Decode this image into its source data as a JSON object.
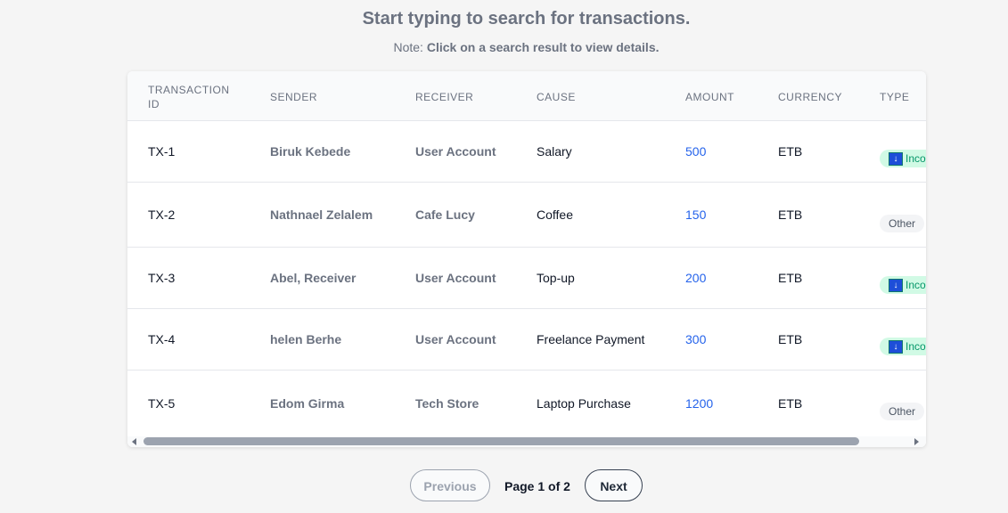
{
  "header": {
    "title": "Start typing to search for transactions.",
    "note_label": "Note:",
    "note_text": "Click on a search result to view details."
  },
  "table": {
    "columns": [
      "TRANSACTION ID",
      "SENDER",
      "RECEIVER",
      "CAUSE",
      "AMOUNT",
      "CURRENCY",
      "TYPE"
    ],
    "rows": [
      {
        "id": "TX-1",
        "sender": "Biruk Kebede",
        "receiver": "User Account",
        "cause": "Salary",
        "amount": "500",
        "currency": "ETB",
        "type": "Inco",
        "type_kind": "income"
      },
      {
        "id": "TX-2",
        "sender": "Nathnael Zelalem",
        "receiver": "Cafe Lucy",
        "cause": "Coffee",
        "amount": "150",
        "currency": "ETB",
        "type": "Other",
        "type_kind": "other"
      },
      {
        "id": "TX-3",
        "sender": "Abel, Receiver",
        "receiver": "User Account",
        "cause": "Top-up",
        "amount": "200",
        "currency": "ETB",
        "type": "Inco",
        "type_kind": "income"
      },
      {
        "id": "TX-4",
        "sender": "helen Berhe",
        "receiver": "User Account",
        "cause": "Freelance Payment",
        "amount": "300",
        "currency": "ETB",
        "type": "Inco",
        "type_kind": "income"
      },
      {
        "id": "TX-5",
        "sender": "Edom Girma",
        "receiver": "Tech Store",
        "cause": "Laptop Purchase",
        "amount": "1200",
        "currency": "ETB",
        "type": "Other",
        "type_kind": "other"
      }
    ]
  },
  "pagination": {
    "previous_label": "Previous",
    "page_indicator": "Page 1 of 2",
    "next_label": "Next"
  },
  "colors": {
    "amount": "#2563eb",
    "income_badge_bg": "#d1fae5",
    "income_badge_text": "#059669",
    "other_badge_bg": "#f3f4f6"
  },
  "icons": {
    "income_badge_icon": "arrow-down-icon"
  }
}
